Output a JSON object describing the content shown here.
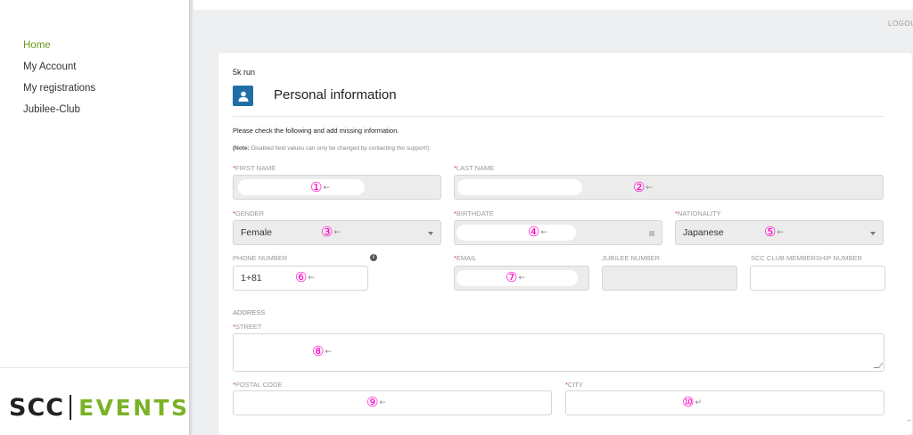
{
  "sidebar": {
    "items": [
      {
        "label": "Home",
        "active": true
      },
      {
        "label": "My Account",
        "active": false
      },
      {
        "label": "My registrations",
        "active": false
      },
      {
        "label": "Jubilee-Club",
        "active": false
      }
    ],
    "logo": {
      "left": "SCC",
      "right": "EVENTS",
      "brand_color": "#7ab226"
    }
  },
  "header": {
    "logout_label": "LOGOUT"
  },
  "form": {
    "event_name": "5k run",
    "section_title": "Personal information",
    "section_icon": "user-icon",
    "hint": "Please check the following and add missing information.",
    "note_prefix": "(Note:",
    "note_text": " Disabled field values can only be changed by contacting the support!)",
    "required_marker": "*",
    "fields": {
      "first_name": {
        "label": "FIRST NAME",
        "value": "",
        "mark": "①"
      },
      "last_name": {
        "label": "LAST NAME",
        "value": "",
        "mark": "②"
      },
      "gender": {
        "label": "GENDER",
        "value": "Female",
        "mark": "③"
      },
      "birthdate": {
        "label": "BIRTHDATE",
        "value": "",
        "mark": "④"
      },
      "nationality": {
        "label": "NATIONALITY",
        "value": "Japanese",
        "mark": "⑤"
      },
      "phone": {
        "label": "PHONE NUMBER",
        "value": "1+81",
        "mark": "⑥"
      },
      "email": {
        "label": "EMAIL",
        "value": "",
        "mark": "⑦"
      },
      "jubilee": {
        "label": "JUBILEE NUMBER",
        "value": ""
      },
      "scc_club": {
        "label": "SCC CLUB MEMBERSHIP NUMBER",
        "value": ""
      },
      "street": {
        "label": "STREET",
        "value": "",
        "mark": "⑧"
      },
      "postal_code": {
        "label": "POSTAL CODE",
        "value": "",
        "mark": "⑨"
      },
      "city": {
        "label": "CITY",
        "value": "",
        "mark": "⑩"
      }
    },
    "address_label": "ADDRESS",
    "arrow_glyph": "←",
    "return_glyph": "↵"
  }
}
